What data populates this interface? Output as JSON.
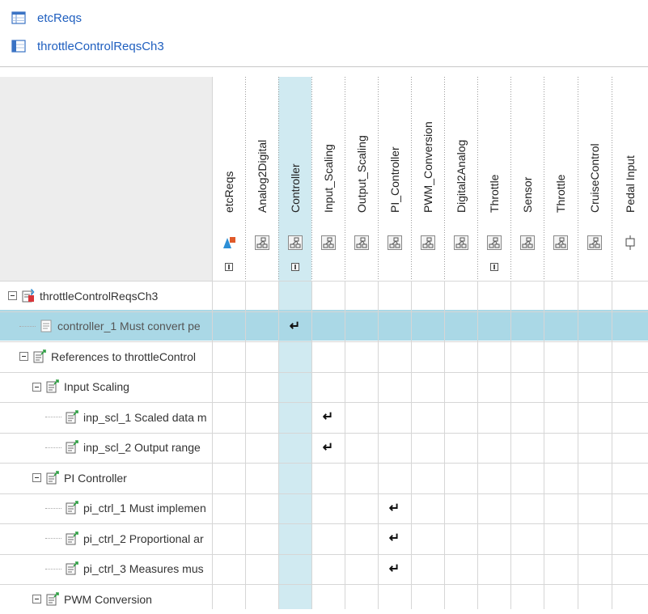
{
  "links": [
    {
      "label": "etcReqs",
      "icon": "req-set-icon"
    },
    {
      "label": "throttleControlReqsCh3",
      "icon": "link-set-icon"
    }
  ],
  "columns": [
    {
      "label": "etcReqs",
      "icon": "req-set-icon",
      "expander": true
    },
    {
      "label": "Analog2Digital",
      "icon": "subsystem-icon",
      "expander": false
    },
    {
      "label": "Controller",
      "icon": "subsystem-icon",
      "expander": true
    },
    {
      "label": "Input_Scaling",
      "icon": "subsystem-icon",
      "expander": false
    },
    {
      "label": "Output_Scaling",
      "icon": "subsystem-icon",
      "expander": false
    },
    {
      "label": "PI_Controller",
      "icon": "subsystem-icon",
      "expander": false
    },
    {
      "label": "PWM_Conversion",
      "icon": "subsystem-icon",
      "expander": false
    },
    {
      "label": "Digital2Analog",
      "icon": "subsystem-icon",
      "expander": false
    },
    {
      "label": "Throttle",
      "icon": "subsystem-icon",
      "expander": true
    },
    {
      "label": "Sensor",
      "icon": "subsystem-icon",
      "expander": false
    },
    {
      "label": "Throttle",
      "icon": "subsystem-icon",
      "expander": false
    },
    {
      "label": "CruiseControl",
      "icon": "subsystem-icon",
      "expander": false
    },
    {
      "label": "Pedal Input",
      "icon": "inport-icon",
      "expander": false
    }
  ],
  "rows": [
    {
      "label": "throttleControlReqsCh3",
      "level": 0,
      "expander": true,
      "icon": "link-set-icon",
      "links": []
    },
    {
      "label": "controller_1 Must convert pe",
      "level": 1,
      "expander": false,
      "icon": "requirement-icon",
      "links": [
        2
      ],
      "selected": true
    },
    {
      "label": "References to throttleControl",
      "level": 1,
      "expander": true,
      "icon": "link-icon",
      "links": []
    },
    {
      "label": "Input Scaling",
      "level": 2,
      "expander": true,
      "icon": "link-icon",
      "links": []
    },
    {
      "label": "inp_scl_1 Scaled data m",
      "level": 3,
      "expander": false,
      "icon": "link-icon",
      "links": [
        3
      ]
    },
    {
      "label": "inp_scl_2 Output range",
      "level": 3,
      "expander": false,
      "icon": "link-icon",
      "links": [
        3
      ]
    },
    {
      "label": "PI Controller",
      "level": 2,
      "expander": true,
      "icon": "link-icon",
      "links": []
    },
    {
      "label": "pi_ctrl_1 Must implemen",
      "level": 3,
      "expander": false,
      "icon": "link-icon",
      "links": [
        5
      ]
    },
    {
      "label": "pi_ctrl_2 Proportional ar",
      "level": 3,
      "expander": false,
      "icon": "link-icon",
      "links": [
        5
      ]
    },
    {
      "label": "pi_ctrl_3 Measures mus",
      "level": 3,
      "expander": false,
      "icon": "link-icon",
      "links": [
        5
      ]
    },
    {
      "label": "PWM Conversion",
      "level": 2,
      "expander": true,
      "icon": "link-icon",
      "links": []
    }
  ],
  "link_glyph": "↵",
  "colors": {
    "selection": "#aad8e6",
    "link_text": "#1f5fbf",
    "grid": "#d6d6d6",
    "header_bg": "#ededed"
  }
}
